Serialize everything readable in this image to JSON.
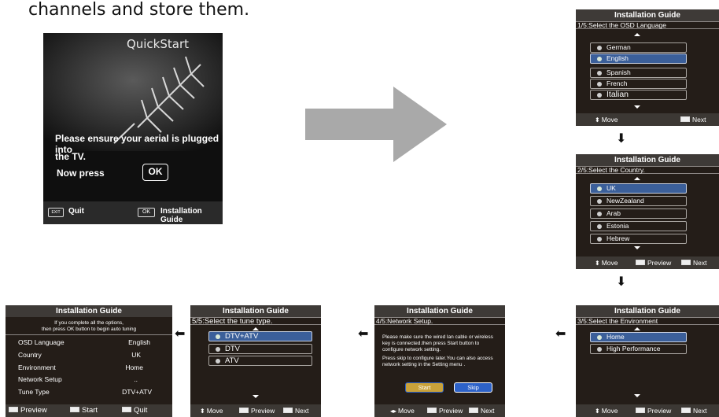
{
  "intro_text": "channels and store them.",
  "quickstart": {
    "title": "QuickStart",
    "msg_line1": "Please ensure your aerial is plugged into",
    "msg_line2": "the TV.",
    "now_press": "Now press",
    "ok_button": "OK",
    "footer": {
      "exit_key": "EXIT",
      "quit": "Quit",
      "ok_key": "OK",
      "guide": "Installation Guide"
    }
  },
  "common": {
    "title": "Installation Guide",
    "move": "Move",
    "next": "Next",
    "preview": "Preview",
    "start": "Start",
    "quit": "Quit"
  },
  "step1": {
    "step": "1/5:Select the OSD Language",
    "options": [
      "German",
      "English",
      "Spanish",
      "French",
      "Italian"
    ],
    "selected": "English"
  },
  "step2": {
    "step": "2/5:Select the Country.",
    "options": [
      "UK",
      "NewZealand",
      "Arab",
      "Estonia",
      "Hebrew"
    ],
    "selected": "UK"
  },
  "step3": {
    "step": "3/5:Select the Environment",
    "options": [
      "Home",
      "High Performance"
    ],
    "selected": "Home"
  },
  "step4": {
    "step": "4/5:Network Setup.",
    "text1": "Please make sure the wired lan cable or wireless key is connected.then press Start button to configure network setting.",
    "text2": "Press skip to configure later.You can also access network setting in the Setting menu .",
    "start_btn": "Start",
    "skip_btn": "Skip"
  },
  "step5": {
    "step": "5/5:Select the tune type.",
    "options": [
      "DTV+ATV",
      "DTV",
      "ATV"
    ],
    "selected": "DTV+ATV"
  },
  "summary": {
    "note_line1": "If you complete all the options,",
    "note_line2": "then press OK button to begin auto tuning",
    "rows": [
      {
        "key": "OSD Language",
        "value": "English"
      },
      {
        "key": "Country",
        "value": "UK"
      },
      {
        "key": "Environment",
        "value": "Home"
      },
      {
        "key": "Network Setup",
        "value": ".."
      },
      {
        "key": "Tune Type",
        "value": "DTV+ATV"
      }
    ]
  },
  "colors": {
    "screen_bg": "#241d18",
    "header_bg": "#3e3a37",
    "selected_bg": "#3b5f9a",
    "arrow_gray": "#a9a9a9",
    "start_btn": "#c9a23a",
    "skip_btn": "#2d62c8"
  }
}
